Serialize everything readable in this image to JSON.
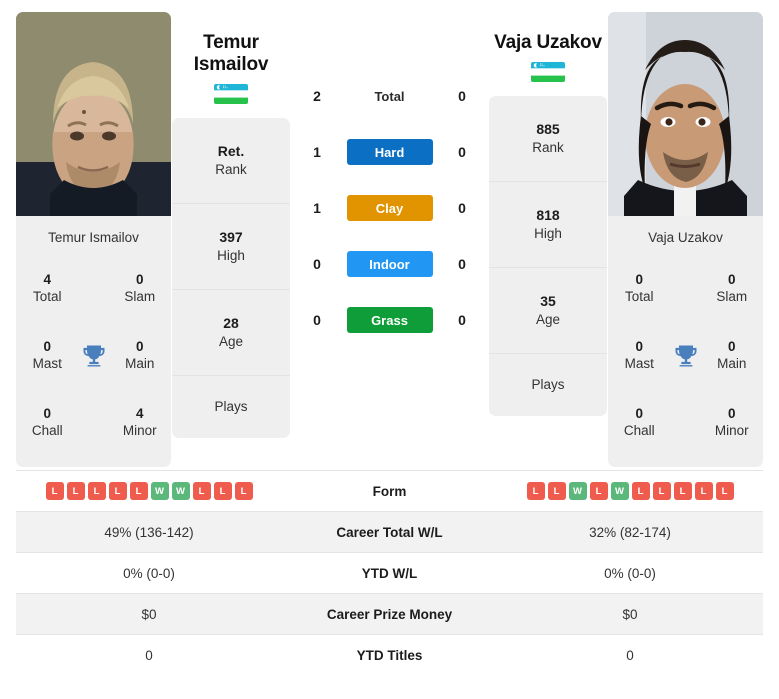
{
  "players": {
    "left": {
      "name_line1": "Temur",
      "name_line2": "Ismailov",
      "full_name": "Temur Ismailov",
      "flag": "uzbekistan-flag",
      "rank": "Ret.",
      "rank_label": "Rank",
      "high": "397",
      "high_label": "High",
      "age": "28",
      "age_label": "Age",
      "plays_label": "Plays",
      "titles": {
        "total": "4",
        "total_label": "Total",
        "slam": "0",
        "slam_label": "Slam",
        "mast": "0",
        "mast_label": "Mast",
        "main": "0",
        "main_label": "Main",
        "chall": "0",
        "chall_label": "Chall",
        "minor": "4",
        "minor_label": "Minor"
      },
      "surface_wins": {
        "total": "2",
        "hard": "1",
        "clay": "1",
        "indoor": "0",
        "grass": "0"
      },
      "form": [
        "L",
        "L",
        "L",
        "L",
        "L",
        "W",
        "W",
        "L",
        "L",
        "L"
      ],
      "career_total_wl": "49% (136-142)",
      "ytd_wl": "0% (0-0)",
      "career_prize_money": "$0",
      "ytd_titles": "0"
    },
    "right": {
      "name_line1": "Vaja Uzakov",
      "name_line2": "",
      "full_name": "Vaja Uzakov",
      "flag": "uzbekistan-flag",
      "rank": "885",
      "rank_label": "Rank",
      "high": "818",
      "high_label": "High",
      "age": "35",
      "age_label": "Age",
      "plays_label": "Plays",
      "titles": {
        "total": "0",
        "total_label": "Total",
        "slam": "0",
        "slam_label": "Slam",
        "mast": "0",
        "mast_label": "Mast",
        "main": "0",
        "main_label": "Main",
        "chall": "0",
        "chall_label": "Chall",
        "minor": "0",
        "minor_label": "Minor"
      },
      "surface_wins": {
        "total": "0",
        "hard": "0",
        "clay": "0",
        "indoor": "0",
        "grass": "0"
      },
      "form": [
        "L",
        "L",
        "W",
        "L",
        "W",
        "L",
        "L",
        "L",
        "L",
        "L"
      ],
      "career_total_wl": "32% (82-174)",
      "ytd_wl": "0% (0-0)",
      "career_prize_money": "$0",
      "ytd_titles": "0"
    }
  },
  "surfaces": {
    "total_label": "Total",
    "hard_label": "Hard",
    "clay_label": "Clay",
    "indoor_label": "Indoor",
    "grass_label": "Grass",
    "colors": {
      "hard": "#0b6fc4",
      "clay": "#e29400",
      "indoor": "#2196f3",
      "grass": "#0f9d3a"
    }
  },
  "table": {
    "form_label": "Form",
    "career_total_wl_label": "Career Total W/L",
    "ytd_wl_label": "YTD W/L",
    "career_prize_money_label": "Career Prize Money",
    "ytd_titles_label": "YTD Titles"
  },
  "theme": {
    "card_bg": "#efefef",
    "win_color": "#5cb87a",
    "loss_color": "#ef5b4c",
    "trophy_color": "#4a7fbe"
  }
}
